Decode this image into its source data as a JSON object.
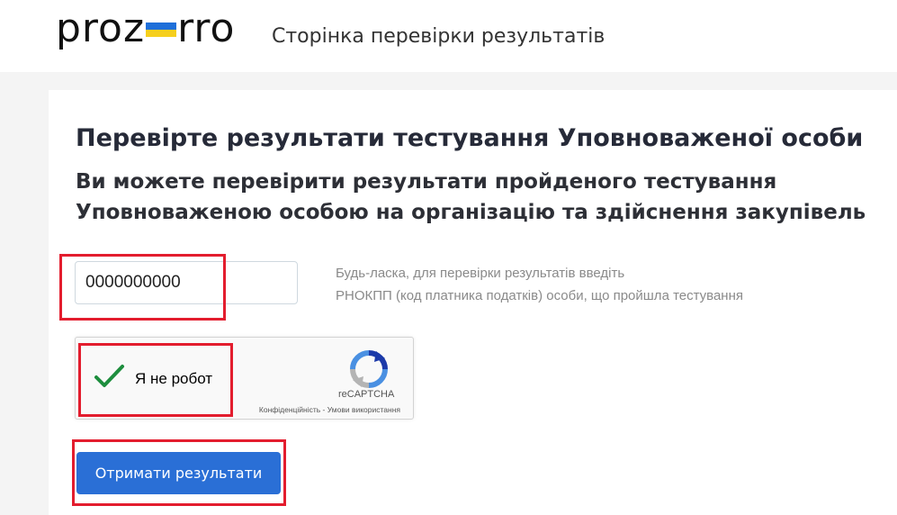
{
  "header": {
    "logo_left": "proz",
    "logo_right": "rro",
    "subtitle": "Сторінка перевірки результатів"
  },
  "main": {
    "title": "Перевірте результати тестування Уповноваженої особи",
    "description": "Ви можете перевірити результати пройденого тестування Уповноваженою особою на організацію та здійснення закупівель",
    "rnokpp_value": "0000000000",
    "hint_line1": "Будь-ласка, для перевірки результатів введіть",
    "hint_line2": "РНОКПП (код платника податків) особи, що пройшла тестування",
    "recaptcha": {
      "label": "Я не робот",
      "brand": "reCAPTCHA",
      "links": "Конфіденційність - Умови використання",
      "checked": true
    },
    "submit_label": "Отримати результати"
  },
  "colors": {
    "accent": "#2a6fd6",
    "highlight": "#e31d2e",
    "check": "#1e8e3e",
    "flag_blue": "#1e6fd9",
    "flag_yellow": "#f6cf1d"
  }
}
